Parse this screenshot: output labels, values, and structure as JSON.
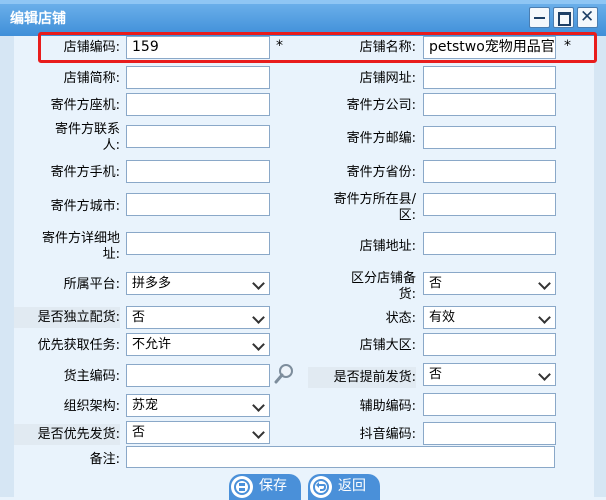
{
  "window": {
    "title": "编辑店铺"
  },
  "fields": {
    "store_code": {
      "label": "店铺编码:",
      "value": "159",
      "required": "*"
    },
    "store_name": {
      "label": "店铺名称:",
      "value": "petstwo宠物用品官方",
      "required": "*"
    },
    "store_short": {
      "label": "店铺简称:",
      "value": ""
    },
    "store_url": {
      "label": "店铺网址:",
      "value": ""
    },
    "sender_landline": {
      "label": "寄件方座机:",
      "value": ""
    },
    "sender_company": {
      "label": "寄件方公司:",
      "value": ""
    },
    "sender_contact_1": "寄件方联系",
    "sender_contact_2": "人:",
    "sender_zip": {
      "label": "寄件方邮编:",
      "value": ""
    },
    "sender_mobile": {
      "label": "寄件方手机:",
      "value": ""
    },
    "sender_province": {
      "label": "寄件方省份:",
      "value": ""
    },
    "sender_city": {
      "label": "寄件方城市:",
      "value": ""
    },
    "sender_county_1": "寄件方所在县/",
    "sender_county_2": "区:",
    "sender_address_1": "寄件方详细地",
    "sender_address_2": "址:",
    "store_address": {
      "label": "店铺地址:",
      "value": ""
    },
    "platform": {
      "label": "所属平台:",
      "value": "拼多多"
    },
    "distinguish_1": "区分店铺备",
    "distinguish_2": "货:",
    "distinguish_value": "否",
    "independent": {
      "label": "是否独立配货:",
      "value": "否"
    },
    "status": {
      "label": "状态:",
      "value": "有效"
    },
    "priority_task": {
      "label": "优先获取任务:",
      "value": "不允许"
    },
    "store_region": {
      "label": "店铺大区:",
      "value": ""
    },
    "owner_code": {
      "label": "货主编码:",
      "value": ""
    },
    "early_ship": {
      "label": "是否提前发货:",
      "value": "否"
    },
    "org": {
      "label": "组织架构:",
      "value": "苏宠"
    },
    "aux_code": {
      "label": "辅助编码:",
      "value": ""
    },
    "priority_ship": {
      "label": "是否优先发货:",
      "value": "否"
    },
    "douyin_code": {
      "label": "抖音编码:",
      "value": ""
    },
    "remark": {
      "label": "备注:",
      "value": ""
    }
  },
  "buttons": {
    "save": "保存",
    "back": "返回"
  },
  "colors": {
    "titlebar": "#3f8fd8",
    "highlight": "#e81c1c",
    "button": "#4a90d9"
  }
}
